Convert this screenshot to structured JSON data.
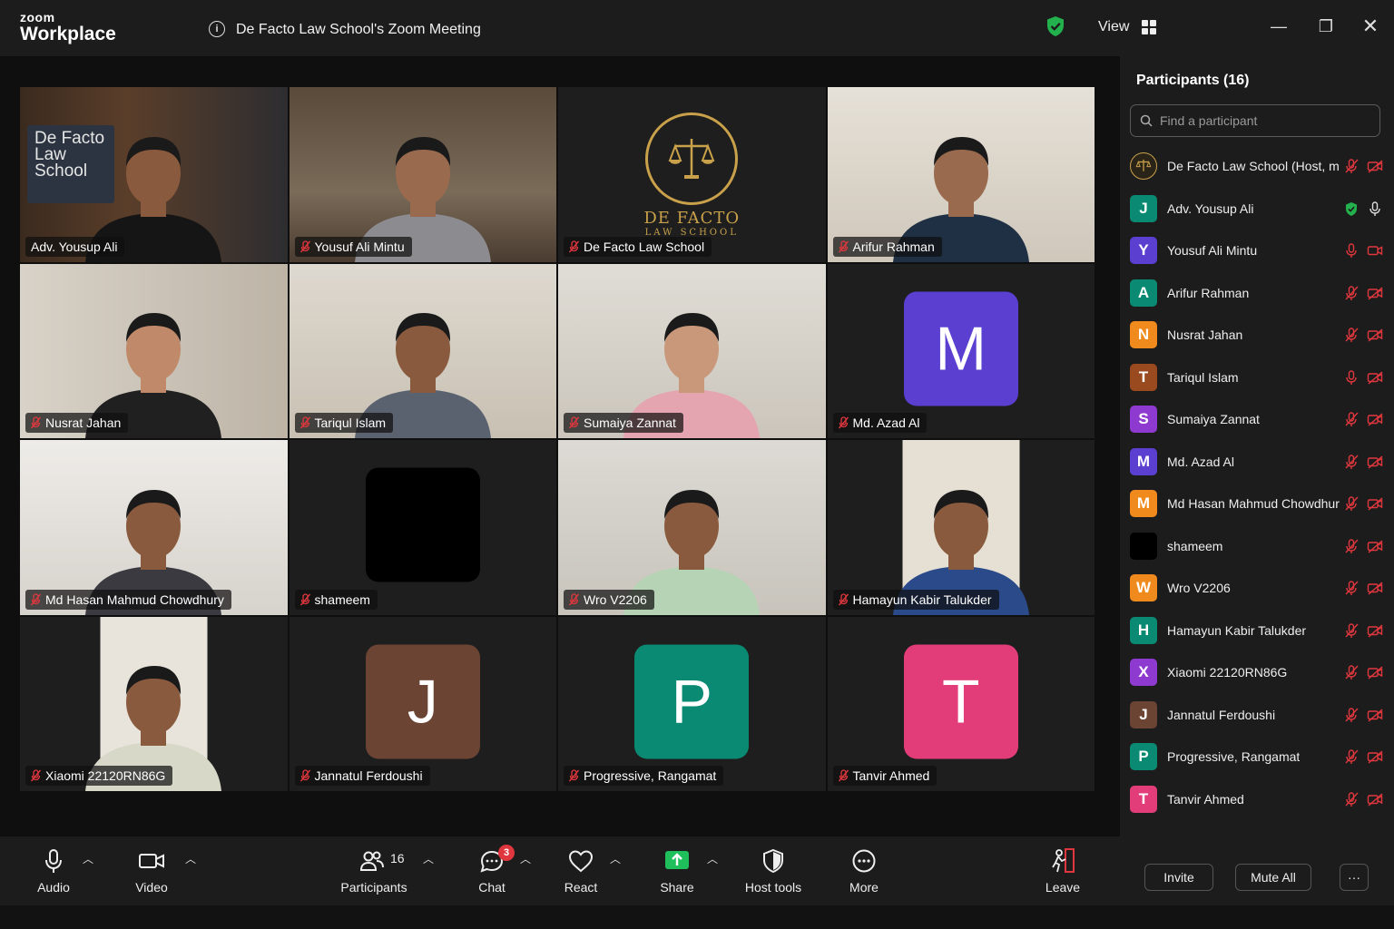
{
  "app": {
    "brand_top": "zoom",
    "brand_main": "Workplace",
    "meeting_title": "De Facto Law School's Zoom Meeting",
    "view_label": "View",
    "window_controls": [
      "minimize-icon",
      "restore-icon",
      "close-icon"
    ]
  },
  "colors": {
    "active_speaker": "#3ad16b",
    "muted_red": "#e0373e",
    "shield_green": "#22b14c"
  },
  "gallery": {
    "tiles": [
      {
        "name": "Adv. Yousup Ali",
        "type": "video",
        "active": true,
        "muted": false,
        "sign": "De Facto Law School"
      },
      {
        "name": "Yousuf Ali Mintu",
        "type": "video",
        "muted": true
      },
      {
        "name": "De Facto Law School",
        "type": "logo",
        "muted": true,
        "logo_title": "DE FACTO",
        "logo_sub": "LAW SCHOOL"
      },
      {
        "name": "Arifur Rahman",
        "type": "video",
        "muted": true
      },
      {
        "name": "Nusrat Jahan",
        "type": "video",
        "muted": true
      },
      {
        "name": "Tariqul Islam",
        "type": "video",
        "muted": true
      },
      {
        "name": "Sumaiya Zannat",
        "type": "video",
        "muted": true
      },
      {
        "name": "Md. Azad Al",
        "type": "avatar",
        "initial": "M",
        "color": "#5b3fd1",
        "muted": true
      },
      {
        "name": "Md Hasan Mahmud Chowdhury",
        "type": "video",
        "muted": true
      },
      {
        "name": "shameem",
        "type": "avatar",
        "initial": "",
        "color": "#000000",
        "muted": true
      },
      {
        "name": "Wro V2206",
        "type": "video",
        "muted": true
      },
      {
        "name": "Hamayun Kabir Talukder",
        "type": "video",
        "muted": true
      },
      {
        "name": "Xiaomi 22120RN86G",
        "type": "video",
        "muted": true
      },
      {
        "name": "Jannatul Ferdoushi",
        "type": "avatar",
        "initial": "J",
        "color": "#6b4433",
        "muted": true
      },
      {
        "name": "Progressive, Rangamat",
        "type": "avatar",
        "initial": "P",
        "color": "#0a8a72",
        "muted": true
      },
      {
        "name": "Tanvir Ahmed",
        "type": "avatar",
        "initial": "T",
        "color": "#e23d78",
        "muted": true
      }
    ]
  },
  "panel": {
    "title": "Participants (16)",
    "search_placeholder": "Find a participant",
    "participants": [
      {
        "name": "De Facto Law School (Host, me)",
        "initial": "",
        "color": "#2a2418",
        "logo": true,
        "mic": "muted",
        "video": "off"
      },
      {
        "name": "Adv. Yousup Ali",
        "initial": "J",
        "color": "#0a8a72",
        "mic": "on",
        "video": "shield"
      },
      {
        "name": "Yousuf Ali Mintu",
        "initial": "Y",
        "color": "#5b3fd1",
        "mic": "muted-on",
        "video": "on-red"
      },
      {
        "name": "Arifur Rahman",
        "initial": "A",
        "color": "#0a8a72",
        "mic": "muted",
        "video": "off"
      },
      {
        "name": "Nusrat Jahan",
        "initial": "N",
        "color": "#f08a1c",
        "mic": "muted",
        "video": "off"
      },
      {
        "name": "Tariqul Islam",
        "initial": "T",
        "color": "#9a4a1f",
        "mic": "muted-on",
        "video": "off"
      },
      {
        "name": "Sumaiya Zannat",
        "initial": "S",
        "color": "#8e3ad1",
        "mic": "muted",
        "video": "off"
      },
      {
        "name": "Md. Azad Al",
        "initial": "M",
        "color": "#5b3fd1",
        "mic": "muted",
        "video": "off"
      },
      {
        "name": "Md Hasan Mahmud Chowdhury",
        "initial": "M",
        "color": "#f08a1c",
        "mic": "muted",
        "video": "off"
      },
      {
        "name": "shameem",
        "initial": "",
        "color": "#000000",
        "mic": "muted",
        "video": "off"
      },
      {
        "name": "Wro V2206",
        "initial": "W",
        "color": "#f08a1c",
        "mic": "muted",
        "video": "off"
      },
      {
        "name": "Hamayun Kabir Talukder",
        "initial": "H",
        "color": "#0a8a72",
        "mic": "muted",
        "video": "off"
      },
      {
        "name": "Xiaomi 22120RN86G",
        "initial": "X",
        "color": "#8e3ad1",
        "mic": "muted",
        "video": "off"
      },
      {
        "name": "Jannatul Ferdoushi",
        "initial": "J",
        "color": "#6b4433",
        "mic": "muted",
        "video": "off"
      },
      {
        "name": "Progressive, Rangamat",
        "initial": "P",
        "color": "#0a8a72",
        "mic": "muted",
        "video": "off"
      },
      {
        "name": "Tanvir Ahmed",
        "initial": "T",
        "color": "#e23d78",
        "mic": "muted",
        "video": "off"
      }
    ],
    "invite_label": "Invite",
    "mute_all_label": "Mute All",
    "more_label": "···"
  },
  "toolbar": {
    "audio": "Audio",
    "video": "Video",
    "participants": "Participants",
    "participants_count": "16",
    "chat": "Chat",
    "chat_badge": "3",
    "react": "React",
    "share": "Share",
    "host_tools": "Host tools",
    "more": "More",
    "leave": "Leave"
  }
}
